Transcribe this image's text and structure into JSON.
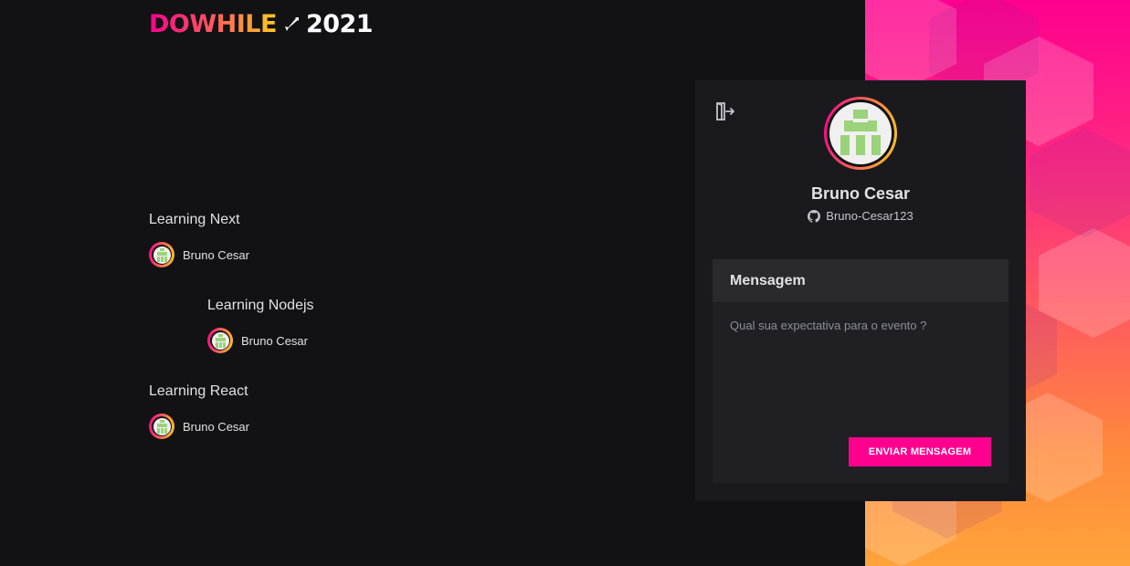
{
  "brand": {
    "logo_word": "DOWHILE",
    "logo_year": "2021",
    "gradient_colors": [
      "#ff008e",
      "#ff5a5f",
      "#ffcd1e"
    ]
  },
  "messages": [
    {
      "text": "Learning Next",
      "user": {
        "name": "Bruno Cesar"
      }
    },
    {
      "text": "Learning Nodejs",
      "user": {
        "name": "Bruno Cesar"
      }
    },
    {
      "text": "Learning React",
      "user": {
        "name": "Bruno Cesar"
      }
    }
  ],
  "profile": {
    "name": "Bruno Cesar",
    "github_login": "Bruno-Cesar123",
    "signout_icon": "sign-out-icon",
    "github_icon": "github-icon"
  },
  "form": {
    "title": "Mensagem",
    "placeholder": "Qual sua expectativa para o evento ?",
    "value": "",
    "submit_label": "ENVIAR MENSAGEM"
  },
  "colors": {
    "background": "#121214",
    "card": "#1a1a1e",
    "form": "#202024",
    "form_header": "#29292e",
    "accent": "#ff008e",
    "text": "#e1e1e6",
    "muted": "#8d8d99"
  }
}
